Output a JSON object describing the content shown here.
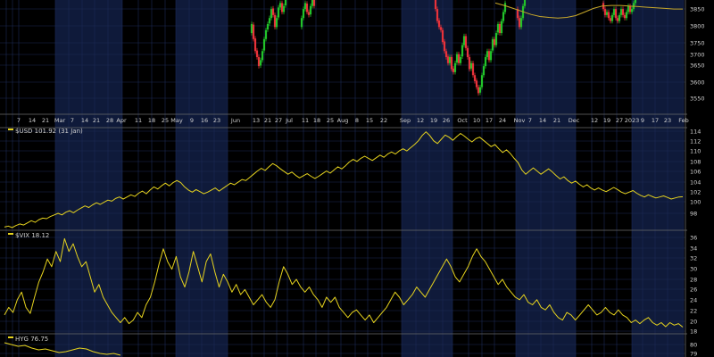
{
  "colors": {
    "background": "#000000",
    "band": "#0f1a3a",
    "grid": "#1c2a55",
    "divider": "#6a6a6a",
    "text": "#cfcfcf",
    "line": "#e6d31e",
    "up": "#22c32a",
    "down": "#e8323a",
    "ma": "#c8a82a"
  },
  "x_axis": {
    "labels": [
      "7",
      "14",
      "21",
      "Mar",
      "7",
      "14",
      "21",
      "28",
      "Apr",
      "11",
      "18",
      "25",
      "May",
      "9",
      "16",
      "23",
      "Jun",
      "13",
      "21",
      "27",
      "Jul",
      "11",
      "18",
      "25",
      "Aug",
      "8",
      "15",
      "22",
      "Sep",
      "12",
      "19",
      "26",
      "Oct",
      "10",
      "17",
      "24",
      "Nov",
      "7",
      "14",
      "21",
      "Dec",
      "12",
      "19",
      "27",
      "2023",
      "9",
      "17",
      "23",
      "Feb"
    ]
  },
  "chart_data": [
    {
      "type": "candlestick",
      "symbol": "",
      "y_ticks": [
        "3850",
        "3800",
        "3750",
        "3700",
        "3650",
        "3600",
        "3550"
      ],
      "ylim": [
        3510,
        3890
      ],
      "moving_average": "overlay line",
      "candles_visible_range": "Jun – Jan",
      "candles": [
        {
          "t": 282,
          "o": 3780,
          "c": 3810
        },
        {
          "t": 284,
          "o": 3808,
          "c": 3760
        },
        {
          "t": 286,
          "o": 3762,
          "c": 3720
        },
        {
          "t": 288,
          "o": 3722,
          "c": 3700
        },
        {
          "t": 290,
          "o": 3700,
          "c": 3670
        },
        {
          "t": 292,
          "o": 3672,
          "c": 3690
        },
        {
          "t": 294,
          "o": 3690,
          "c": 3720
        },
        {
          "t": 296,
          "o": 3722,
          "c": 3760
        },
        {
          "t": 298,
          "o": 3760,
          "c": 3790
        },
        {
          "t": 300,
          "o": 3792,
          "c": 3810
        },
        {
          "t": 302,
          "o": 3812,
          "c": 3830
        },
        {
          "t": 304,
          "o": 3830,
          "c": 3860
        },
        {
          "t": 306,
          "o": 3862,
          "c": 3840
        },
        {
          "t": 308,
          "o": 3840,
          "c": 3800
        },
        {
          "t": 310,
          "o": 3800,
          "c": 3830
        },
        {
          "t": 312,
          "o": 3832,
          "c": 3865
        },
        {
          "t": 314,
          "o": 3865,
          "c": 3880
        },
        {
          "t": 316,
          "o": 3880,
          "c": 3850
        },
        {
          "t": 318,
          "o": 3850,
          "c": 3870
        },
        {
          "t": 320,
          "o": 3872,
          "c": 3890
        },
        {
          "t": 338,
          "o": 3800,
          "c": 3830
        },
        {
          "t": 340,
          "o": 3830,
          "c": 3860
        },
        {
          "t": 342,
          "o": 3860,
          "c": 3880
        },
        {
          "t": 344,
          "o": 3878,
          "c": 3850
        },
        {
          "t": 346,
          "o": 3850,
          "c": 3840
        },
        {
          "t": 348,
          "o": 3842,
          "c": 3870
        },
        {
          "t": 350,
          "o": 3870,
          "c": 3890
        },
        {
          "t": 352,
          "o": 3890,
          "c": 3870
        },
        {
          "t": 488,
          "o": 3890,
          "c": 3860
        },
        {
          "t": 490,
          "o": 3860,
          "c": 3820
        },
        {
          "t": 492,
          "o": 3822,
          "c": 3800
        },
        {
          "t": 494,
          "o": 3800,
          "c": 3790
        },
        {
          "t": 496,
          "o": 3790,
          "c": 3750
        },
        {
          "t": 498,
          "o": 3752,
          "c": 3720
        },
        {
          "t": 500,
          "o": 3720,
          "c": 3700
        },
        {
          "t": 502,
          "o": 3702,
          "c": 3680
        },
        {
          "t": 504,
          "o": 3680,
          "c": 3700
        },
        {
          "t": 506,
          "o": 3700,
          "c": 3660
        },
        {
          "t": 508,
          "o": 3662,
          "c": 3650
        },
        {
          "t": 510,
          "o": 3650,
          "c": 3680
        },
        {
          "t": 512,
          "o": 3682,
          "c": 3710
        },
        {
          "t": 514,
          "o": 3710,
          "c": 3680
        },
        {
          "t": 516,
          "o": 3680,
          "c": 3700
        },
        {
          "t": 518,
          "o": 3702,
          "c": 3740
        },
        {
          "t": 520,
          "o": 3740,
          "c": 3770
        },
        {
          "t": 522,
          "o": 3770,
          "c": 3730
        },
        {
          "t": 524,
          "o": 3730,
          "c": 3700
        },
        {
          "t": 526,
          "o": 3700,
          "c": 3660
        },
        {
          "t": 528,
          "o": 3662,
          "c": 3680
        },
        {
          "t": 530,
          "o": 3680,
          "c": 3640
        },
        {
          "t": 532,
          "o": 3640,
          "c": 3620
        },
        {
          "t": 534,
          "o": 3622,
          "c": 3600
        },
        {
          "t": 536,
          "o": 3600,
          "c": 3580
        },
        {
          "t": 538,
          "o": 3582,
          "c": 3600
        },
        {
          "t": 540,
          "o": 3600,
          "c": 3640
        },
        {
          "t": 542,
          "o": 3640,
          "c": 3670
        },
        {
          "t": 544,
          "o": 3670,
          "c": 3700
        },
        {
          "t": 546,
          "o": 3700,
          "c": 3720
        },
        {
          "t": 548,
          "o": 3720,
          "c": 3690
        },
        {
          "t": 550,
          "o": 3690,
          "c": 3720
        },
        {
          "t": 552,
          "o": 3722,
          "c": 3760
        },
        {
          "t": 554,
          "o": 3760,
          "c": 3740
        },
        {
          "t": 556,
          "o": 3740,
          "c": 3780
        },
        {
          "t": 558,
          "o": 3782,
          "c": 3810
        },
        {
          "t": 560,
          "o": 3810,
          "c": 3780
        },
        {
          "t": 562,
          "o": 3780,
          "c": 3820
        },
        {
          "t": 564,
          "o": 3820,
          "c": 3850
        },
        {
          "t": 566,
          "o": 3850,
          "c": 3880
        },
        {
          "t": 580,
          "o": 3860,
          "c": 3830
        },
        {
          "t": 582,
          "o": 3830,
          "c": 3800
        },
        {
          "t": 584,
          "o": 3800,
          "c": 3830
        },
        {
          "t": 586,
          "o": 3830,
          "c": 3870
        },
        {
          "t": 588,
          "o": 3870,
          "c": 3890
        },
        {
          "t": 676,
          "o": 3880,
          "c": 3860
        },
        {
          "t": 678,
          "o": 3860,
          "c": 3840
        },
        {
          "t": 680,
          "o": 3840,
          "c": 3850
        },
        {
          "t": 682,
          "o": 3850,
          "c": 3830
        },
        {
          "t": 684,
          "o": 3830,
          "c": 3820
        },
        {
          "t": 686,
          "o": 3820,
          "c": 3840
        },
        {
          "t": 688,
          "o": 3840,
          "c": 3860
        },
        {
          "t": 690,
          "o": 3860,
          "c": 3830
        },
        {
          "t": 692,
          "o": 3830,
          "c": 3820
        },
        {
          "t": 694,
          "o": 3820,
          "c": 3840
        },
        {
          "t": 696,
          "o": 3840,
          "c": 3860
        },
        {
          "t": 698,
          "o": 3860,
          "c": 3840
        },
        {
          "t": 700,
          "o": 3840,
          "c": 3830
        },
        {
          "t": 702,
          "o": 3830,
          "c": 3850
        },
        {
          "t": 704,
          "o": 3850,
          "c": 3870
        },
        {
          "t": 706,
          "o": 3870,
          "c": 3850
        },
        {
          "t": 708,
          "o": 3850,
          "c": 3860
        },
        {
          "t": 710,
          "o": 3860,
          "c": 3880
        },
        {
          "t": 712,
          "o": 3880,
          "c": 3890
        }
      ],
      "ma_points": [
        [
          555,
          3880
        ],
        [
          565,
          3872
        ],
        [
          575,
          3862
        ],
        [
          585,
          3852
        ],
        [
          595,
          3842
        ],
        [
          605,
          3835
        ],
        [
          615,
          3832
        ],
        [
          625,
          3830
        ],
        [
          635,
          3832
        ],
        [
          645,
          3838
        ],
        [
          655,
          3850
        ],
        [
          665,
          3862
        ],
        [
          675,
          3870
        ],
        [
          685,
          3872
        ],
        [
          695,
          3872
        ],
        [
          705,
          3870
        ],
        [
          715,
          3868
        ],
        [
          725,
          3866
        ],
        [
          735,
          3864
        ],
        [
          745,
          3862
        ],
        [
          755,
          3860
        ],
        [
          765,
          3860
        ]
      ]
    },
    {
      "type": "line",
      "label": "$USD 101.92 (31 Jan)",
      "y_ticks": [
        "114",
        "112",
        "110",
        "108",
        "106",
        "104",
        "102",
        "100",
        "98"
      ],
      "ylim": [
        95.6,
        115.0
      ],
      "x_range": [
        5,
        765
      ],
      "values": [
        96.2,
        96.4,
        96.1,
        96.5,
        96.8,
        96.6,
        97.0,
        97.4,
        97.1,
        97.6,
        97.9,
        97.8,
        98.2,
        98.5,
        98.8,
        98.5,
        99.0,
        99.3,
        98.9,
        99.4,
        99.8,
        100.2,
        99.9,
        100.4,
        100.8,
        100.5,
        100.9,
        101.3,
        101.1,
        101.6,
        101.9,
        101.5,
        101.9,
        102.3,
        102.0,
        102.6,
        103.0,
        102.5,
        103.2,
        103.8,
        103.4,
        104.0,
        104.5,
        104.0,
        104.6,
        105.0,
        104.6,
        103.8,
        103.2,
        102.8,
        103.3,
        102.9,
        102.5,
        102.8,
        103.2,
        103.6,
        103.0,
        103.5,
        104.0,
        104.5,
        104.2,
        104.7,
        105.2,
        105.0,
        105.6,
        106.2,
        106.8,
        107.3,
        106.9,
        107.6,
        108.2,
        107.8,
        107.2,
        106.7,
        106.2,
        106.6,
        106.0,
        105.5,
        105.9,
        106.3,
        105.8,
        105.4,
        105.8,
        106.3,
        106.8,
        106.4,
        107.0,
        107.6,
        107.2,
        107.8,
        108.5,
        109.0,
        108.6,
        109.2,
        109.6,
        109.2,
        108.8,
        109.3,
        109.8,
        109.4,
        110.0,
        110.4,
        110.0,
        110.6,
        111.0,
        110.6,
        111.2,
        111.8,
        112.5,
        113.5,
        114.2,
        113.5,
        112.5,
        112.0,
        112.8,
        113.6,
        113.2,
        112.6,
        113.3,
        113.9,
        113.4,
        112.8,
        112.3,
        112.9,
        113.2,
        112.6,
        112.0,
        111.4,
        111.8,
        111.0,
        110.3,
        110.8,
        110.1,
        109.2,
        108.4,
        107.0,
        106.2,
        106.8,
        107.4,
        106.8,
        106.2,
        106.7,
        107.2,
        106.6,
        105.9,
        105.3,
        105.7,
        105.0,
        104.5,
        104.9,
        104.3,
        103.8,
        104.2,
        103.6,
        103.2,
        103.6,
        103.2,
        102.9,
        103.3,
        103.7,
        103.3,
        102.8,
        102.5,
        102.8,
        103.1,
        102.6,
        102.2,
        101.9,
        102.3,
        102.0,
        101.7,
        101.9,
        102.1,
        101.8,
        101.5,
        101.7,
        101.9,
        101.92
      ]
    },
    {
      "type": "line",
      "label": "$VIX 18.12",
      "y_ticks": [
        "36",
        "34",
        "32",
        "30",
        "28",
        "26",
        "24",
        "22",
        "20",
        "18"
      ],
      "ylim": [
        16.8,
        36.8
      ],
      "x_range": [
        5,
        765
      ],
      "values": [
        20.5,
        22.0,
        21.0,
        23.5,
        25.0,
        22.0,
        20.8,
        24.0,
        27.0,
        29.0,
        31.5,
        30.0,
        33.0,
        31.0,
        35.5,
        33.0,
        34.5,
        32.0,
        30.0,
        31.0,
        28.0,
        25.0,
        26.5,
        24.0,
        22.5,
        21.0,
        20.0,
        19.0,
        20.0,
        18.8,
        19.5,
        21.0,
        20.0,
        22.5,
        24.0,
        27.0,
        30.5,
        33.5,
        31.0,
        29.5,
        32.0,
        28.0,
        26.0,
        29.0,
        33.0,
        30.0,
        27.0,
        31.0,
        32.5,
        29.0,
        26.0,
        28.5,
        27.0,
        25.0,
        26.5,
        24.5,
        25.5,
        24.0,
        22.5,
        23.5,
        24.5,
        23.0,
        22.0,
        23.5,
        27.0,
        30.0,
        28.5,
        26.5,
        27.5,
        26.0,
        25.0,
        26.0,
        24.5,
        23.5,
        22.0,
        24.0,
        23.0,
        24.0,
        22.0,
        21.0,
        20.0,
        21.0,
        21.5,
        20.5,
        19.5,
        20.5,
        19.0,
        20.0,
        21.0,
        22.0,
        23.5,
        25.0,
        24.0,
        22.5,
        23.5,
        24.5,
        26.0,
        25.0,
        24.0,
        25.5,
        27.0,
        28.5,
        30.0,
        31.5,
        30.0,
        28.0,
        27.0,
        28.5,
        30.0,
        32.0,
        33.5,
        32.0,
        31.0,
        29.5,
        28.0,
        26.5,
        27.5,
        26.0,
        25.0,
        24.0,
        23.5,
        24.5,
        23.0,
        22.5,
        23.5,
        22.0,
        21.5,
        22.5,
        21.0,
        20.0,
        19.5,
        21.0,
        20.5,
        19.5,
        20.5,
        21.5,
        22.5,
        21.5,
        20.5,
        21.0,
        22.0,
        21.0,
        20.5,
        21.5,
        20.5,
        20.0,
        19.0,
        19.5,
        18.8,
        19.5,
        20.0,
        19.0,
        18.5,
        19.0,
        18.2,
        19.0,
        18.5,
        18.8,
        18.12
      ]
    },
    {
      "type": "line",
      "label": "HYG 76.75",
      "y_ticks": [
        "80",
        "79"
      ],
      "ylim": [
        78.6,
        80.8
      ],
      "x_range": [
        5,
        135
      ],
      "values": [
        80.2,
        80.0,
        79.8,
        79.9,
        79.6,
        79.4,
        79.5,
        79.3,
        79.1,
        79.2,
        79.4,
        79.6,
        79.5,
        79.2,
        79.0,
        78.9,
        79.0,
        78.8
      ]
    }
  ]
}
